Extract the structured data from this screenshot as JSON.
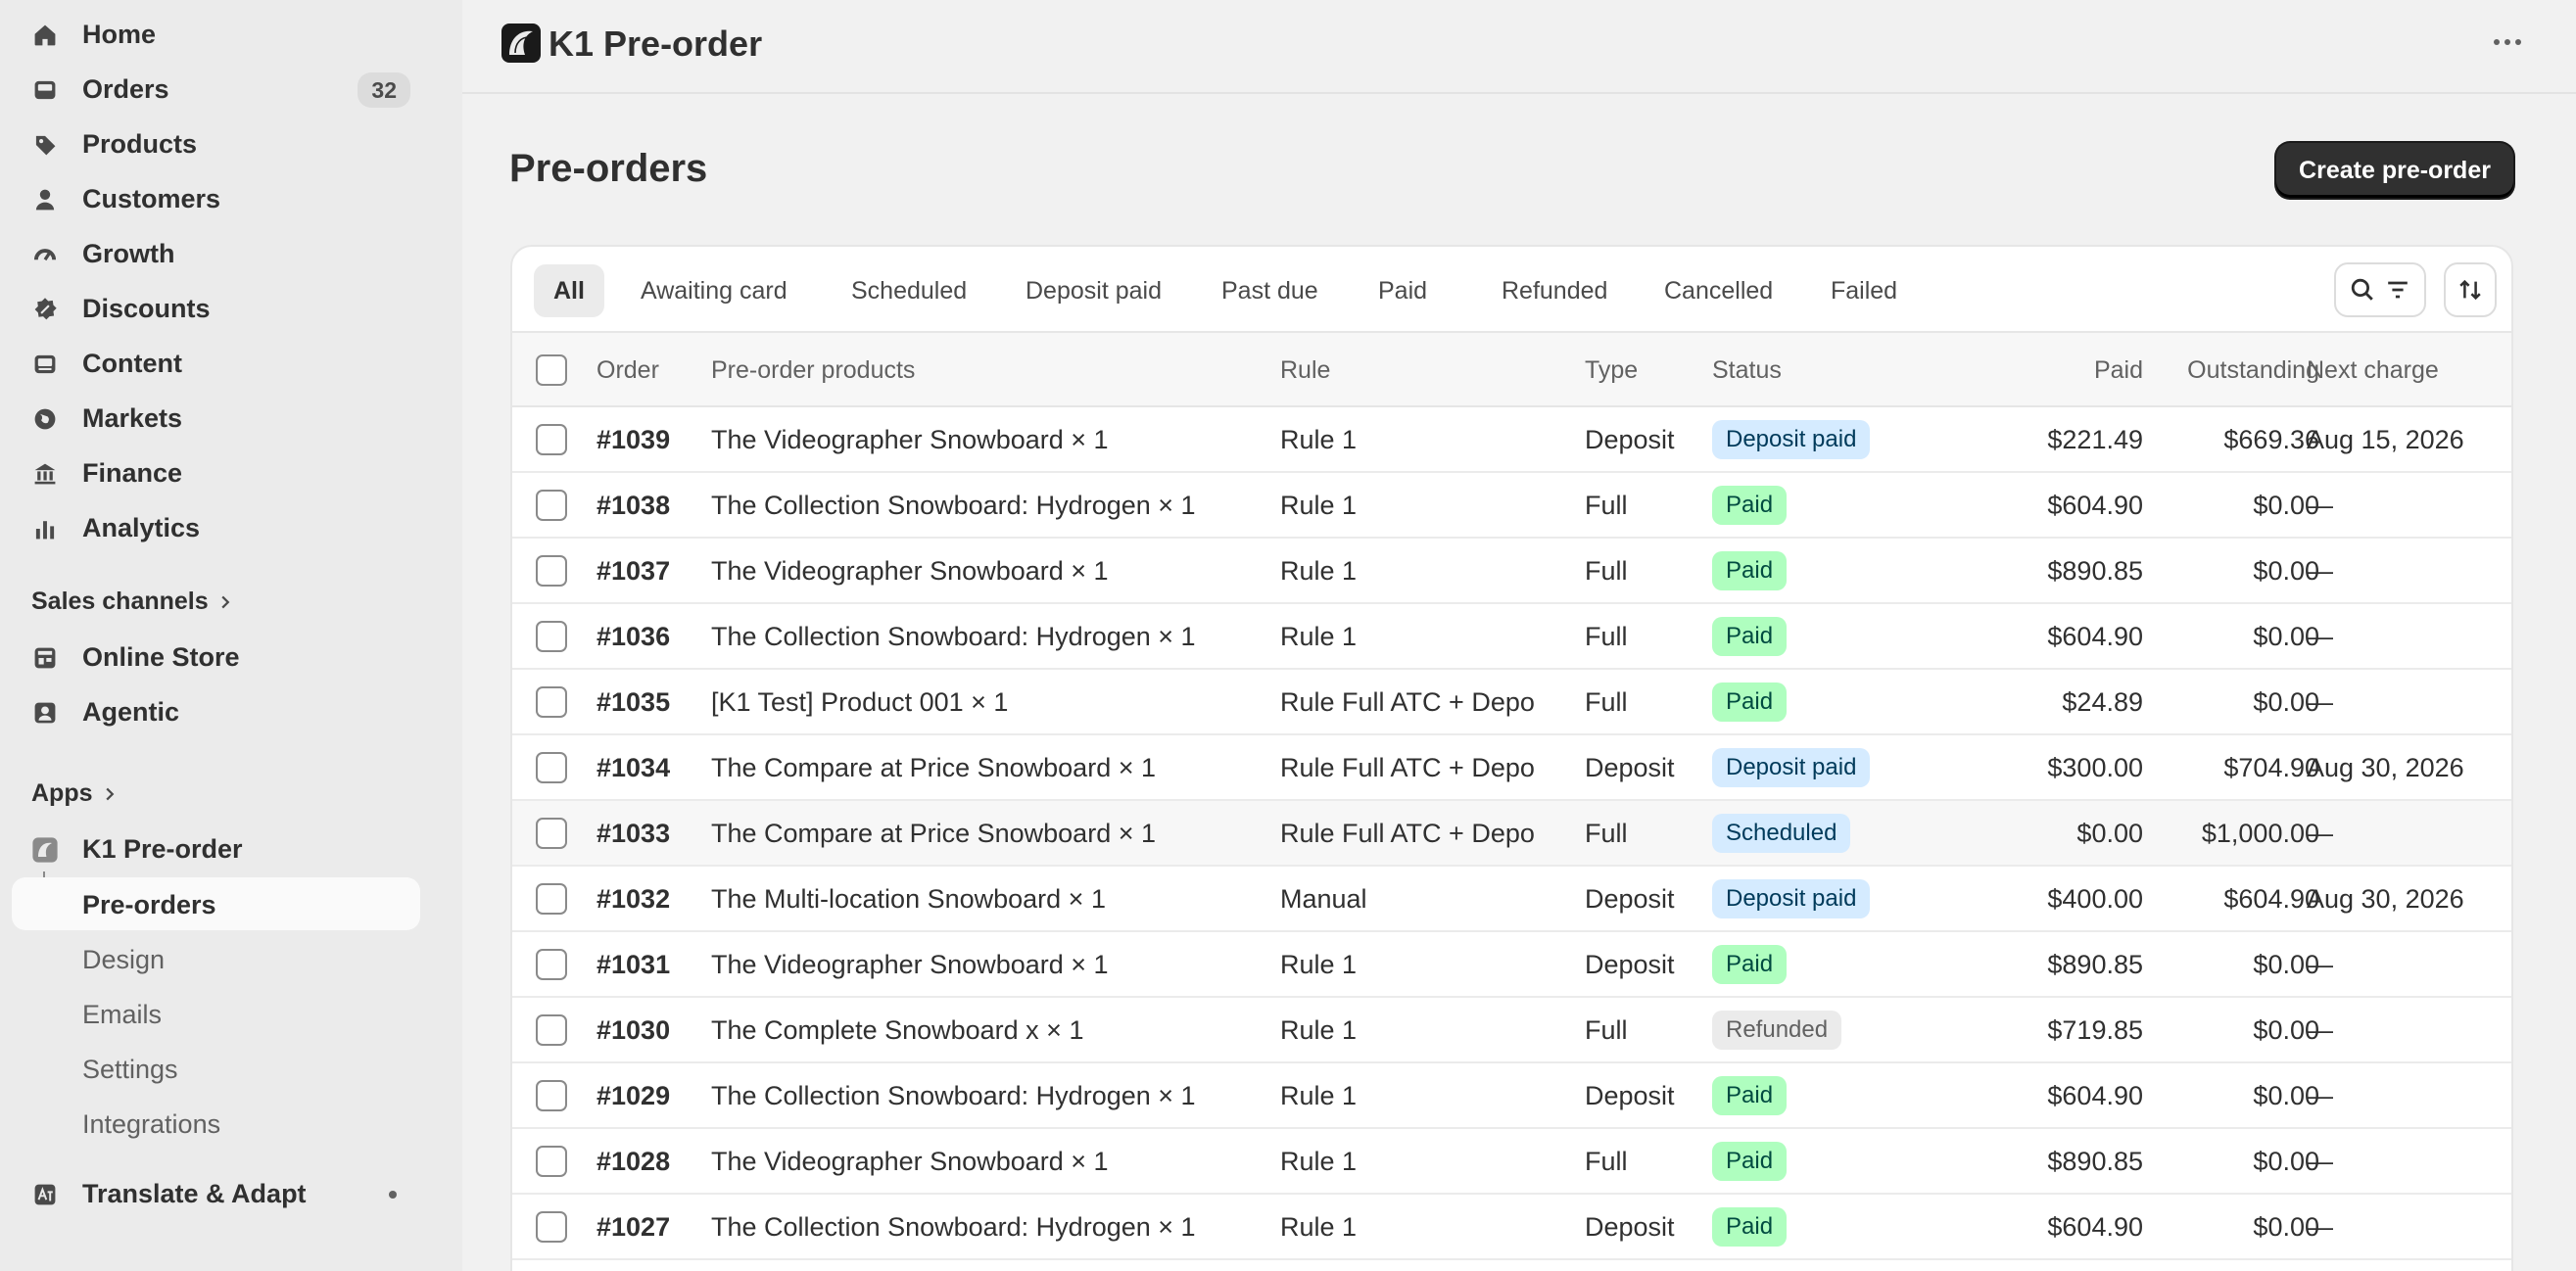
{
  "sidebar": {
    "items": [
      {
        "label": "Home",
        "icon": "home-icon"
      },
      {
        "label": "Orders",
        "icon": "inbox-icon",
        "badge": "32"
      },
      {
        "label": "Products",
        "icon": "tag-icon"
      },
      {
        "label": "Customers",
        "icon": "person-icon"
      },
      {
        "label": "Growth",
        "icon": "gauge-icon"
      },
      {
        "label": "Discounts",
        "icon": "discount-icon"
      },
      {
        "label": "Content",
        "icon": "image-icon"
      },
      {
        "label": "Markets",
        "icon": "globe-icon"
      },
      {
        "label": "Finance",
        "icon": "bank-icon"
      },
      {
        "label": "Analytics",
        "icon": "bar-chart-icon"
      }
    ],
    "sales_channels_label": "Sales channels",
    "channels": [
      {
        "label": "Online Store",
        "icon": "store-icon"
      },
      {
        "label": "Agentic",
        "icon": "agent-icon"
      }
    ],
    "apps_label": "Apps",
    "app_name": "K1 Pre-order",
    "app_subitems": [
      "Pre-orders",
      "Design",
      "Emails",
      "Settings",
      "Integrations"
    ],
    "other_app": "Translate & Adapt"
  },
  "header": {
    "app_title": "K1 Pre-order"
  },
  "page": {
    "title": "Pre-orders",
    "create_button": "Create pre-order"
  },
  "tabs": [
    "All",
    "Awaiting card",
    "Scheduled",
    "Deposit paid",
    "Past due",
    "Paid",
    "Refunded",
    "Cancelled",
    "Failed"
  ],
  "table": {
    "headers": {
      "order": "Order",
      "products": "Pre-order products",
      "rule": "Rule",
      "type": "Type",
      "status": "Status",
      "paid": "Paid",
      "outstanding": "Outstanding",
      "next_charge": "Next charge"
    },
    "rows": [
      {
        "order": "#1039",
        "products": "The Videographer Snowboard × 1",
        "rule": "Rule 1",
        "type": "Deposit",
        "status": "Deposit paid",
        "status_kind": "deposit",
        "paid": "$221.49",
        "outstanding": "$669.36",
        "next": "Aug 15, 2026"
      },
      {
        "order": "#1038",
        "products": "The Collection Snowboard: Hydrogen × 1",
        "rule": "Rule 1",
        "type": "Full",
        "status": "Paid",
        "status_kind": "paid",
        "paid": "$604.90",
        "outstanding": "$0.00",
        "next": "—"
      },
      {
        "order": "#1037",
        "products": "The Videographer Snowboard × 1",
        "rule": "Rule 1",
        "type": "Full",
        "status": "Paid",
        "status_kind": "paid",
        "paid": "$890.85",
        "outstanding": "$0.00",
        "next": "—"
      },
      {
        "order": "#1036",
        "products": "The Collection Snowboard: Hydrogen × 1",
        "rule": "Rule 1",
        "type": "Full",
        "status": "Paid",
        "status_kind": "paid",
        "paid": "$604.90",
        "outstanding": "$0.00",
        "next": "—"
      },
      {
        "order": "#1035",
        "products": "[K1 Test] Product 001 × 1",
        "rule": "Rule Full ATC + Depo",
        "type": "Full",
        "status": "Paid",
        "status_kind": "paid",
        "paid": "$24.89",
        "outstanding": "$0.00",
        "next": "—"
      },
      {
        "order": "#1034",
        "products": "The Compare at Price Snowboard × 1",
        "rule": "Rule Full ATC + Depo",
        "type": "Deposit",
        "status": "Deposit paid",
        "status_kind": "deposit",
        "paid": "$300.00",
        "outstanding": "$704.90",
        "next": "Aug 30, 2026"
      },
      {
        "order": "#1033",
        "products": "The Compare at Price Snowboard × 1",
        "rule": "Rule Full ATC + Depo",
        "type": "Full",
        "status": "Scheduled",
        "status_kind": "scheduled",
        "paid": "$0.00",
        "outstanding": "$1,000.00",
        "next": "—"
      },
      {
        "order": "#1032",
        "products": "The Multi-location Snowboard × 1",
        "rule": "Manual",
        "type": "Deposit",
        "status": "Deposit paid",
        "status_kind": "deposit",
        "paid": "$400.00",
        "outstanding": "$604.90",
        "next": "Aug 30, 2026"
      },
      {
        "order": "#1031",
        "products": "The Videographer Snowboard × 1",
        "rule": "Rule 1",
        "type": "Deposit",
        "status": "Paid",
        "status_kind": "paid",
        "paid": "$890.85",
        "outstanding": "$0.00",
        "next": "—"
      },
      {
        "order": "#1030",
        "products": "The Complete Snowboard x × 1",
        "rule": "Rule 1",
        "type": "Full",
        "status": "Refunded",
        "status_kind": "refunded",
        "paid": "$719.85",
        "outstanding": "$0.00",
        "next": "—"
      },
      {
        "order": "#1029",
        "products": "The Collection Snowboard: Hydrogen × 1",
        "rule": "Rule 1",
        "type": "Deposit",
        "status": "Paid",
        "status_kind": "paid",
        "paid": "$604.90",
        "outstanding": "$0.00",
        "next": "—"
      },
      {
        "order": "#1028",
        "products": "The Videographer Snowboard × 1",
        "rule": "Rule 1",
        "type": "Full",
        "status": "Paid",
        "status_kind": "paid",
        "paid": "$890.85",
        "outstanding": "$0.00",
        "next": "—"
      },
      {
        "order": "#1027",
        "products": "The Collection Snowboard: Hydrogen × 1",
        "rule": "Rule 1",
        "type": "Deposit",
        "status": "Paid",
        "status_kind": "paid",
        "paid": "$604.90",
        "outstanding": "$0.00",
        "next": "—"
      }
    ]
  }
}
